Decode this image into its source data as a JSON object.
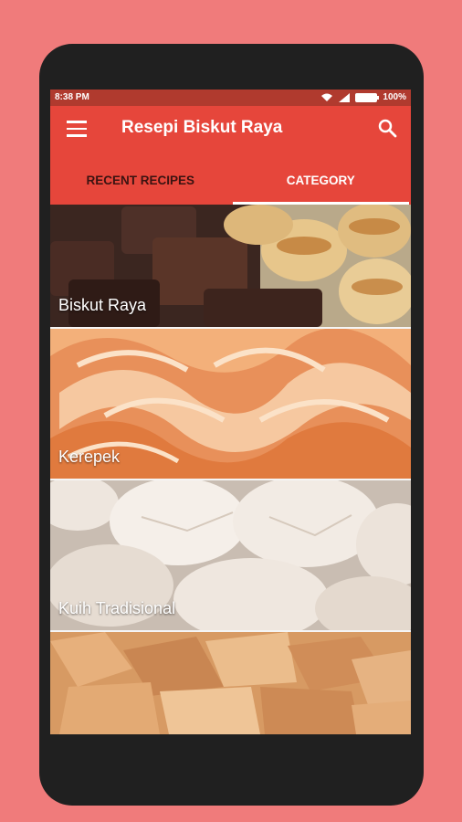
{
  "status_bar": {
    "time": "8:38 PM",
    "battery": "100%"
  },
  "app_bar": {
    "title": "Resepi Biskut Raya"
  },
  "tabs": [
    {
      "label": "RECENT RECIPES",
      "active": false
    },
    {
      "label": "CATEGORY",
      "active": true
    }
  ],
  "categories": [
    {
      "label": "Biskut Raya"
    },
    {
      "label": "Kerepek"
    },
    {
      "label": "Kuih Tradisional"
    },
    {
      "label": ""
    }
  ],
  "colors": {
    "background": "#f07b7b",
    "primary": "#e6463b",
    "status_bar": "#b03a2e"
  }
}
